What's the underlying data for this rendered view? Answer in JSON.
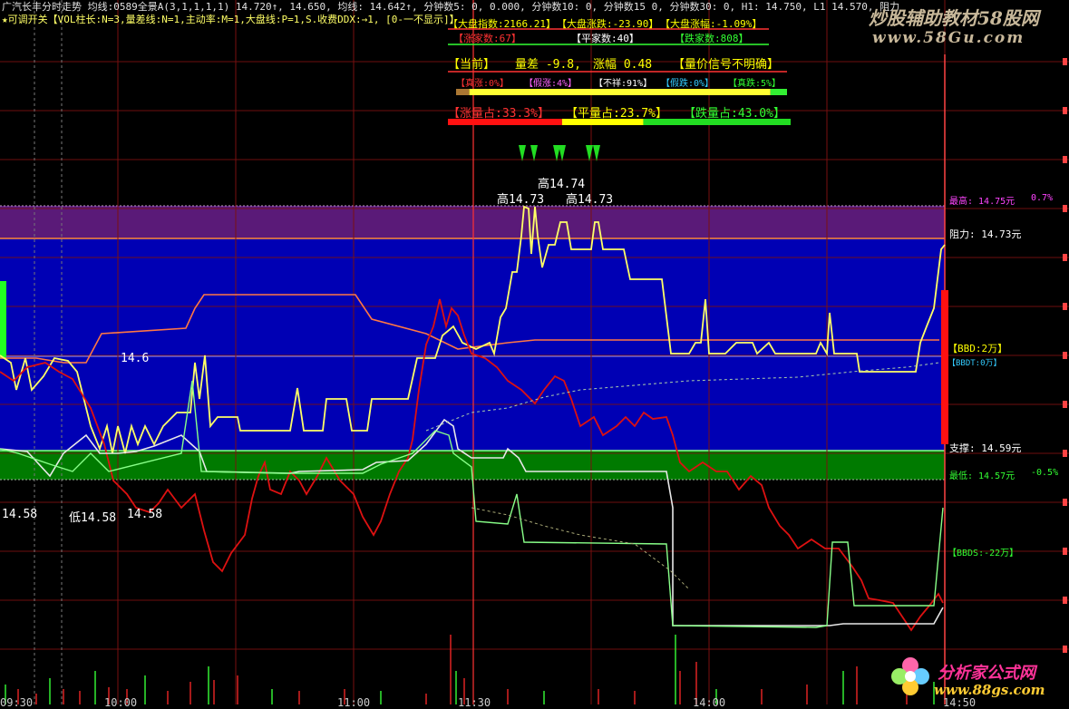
{
  "colors": {
    "background": "#000000",
    "grid": "#7a1010",
    "price_line": "#ffff66",
    "avg_line": "#ff6633",
    "red_line": "#dd1111",
    "white_line": "#e8e8e8",
    "green_line": "#66ff66",
    "zone_blue": "#0000b4",
    "zone_purple": "#5a1a78",
    "zone_green": "#007a00",
    "label_magenta": "#ff44ff",
    "label_yellow": "#ffff00",
    "label_green": "#33ff33",
    "label_cyan": "#33ccff"
  },
  "header": {
    "line1": "广汽长丰分时走势  均线:0589全景A(3,1,1,1,1) 14.720↑, 14.650, 均线: 14.642↑, 分钟数5: 0, 0.000, 分钟数10: 0, 分钟数15  0, 分钟数30: 0, H1: 14.750, L1  14.570, 阻力",
    "line2": "★可调开关【VOL柱长:N=3,量差线:N=1,主动率:M=1,大盘线:P=1,S.收费DDX:→1, [0-一不显示]】"
  },
  "market_panel": {
    "index": "【大盘指数:2166.21】",
    "index_change": "【大盘涨跌:-23.90】",
    "index_pct": "【大盘涨幅:-1.09%】",
    "up_count": "【涨家数:67】",
    "flat_count": "【平家数:40】",
    "down_count": "【跌家数:808】",
    "current_tag": "【当前】",
    "vol_diff": "量差 -9.8,",
    "change_pct": "涨幅 0.48",
    "signal": "【量价信号不明确】",
    "real_up": "【真涨:0%】",
    "fake_up": "【假涨:4%】",
    "unclear": "【不祥:91%】",
    "fake_down": "【假跌:0%】",
    "real_down": "【真跌:5%】",
    "up_vol": "【涨量占:33.3%】",
    "flat_vol": "【平量占:23.7%】",
    "down_vol": "【跌量占:43.0%】",
    "ratios": {
      "real_up": 0.0,
      "fake_up": 0.04,
      "unclear": 0.91,
      "fake_down": 0.0,
      "real_down": 0.05,
      "up_vol": 0.333,
      "flat_vol": 0.237,
      "down_vol": 0.43
    }
  },
  "annotations": {
    "high1": "高14.74",
    "high2": "高14.73",
    "high3": "高14.73",
    "price_mid": "14.6",
    "price_left": "14.58",
    "low_label": "低14.58",
    "low_label2": "14.58"
  },
  "right_labels": {
    "max": "最高: 14.75元",
    "max_pct": "0.7%",
    "resistance": "阻力: 14.73元",
    "bbd": "【BBD:2万】",
    "bbdt": "【BBDT:0万】",
    "support": "支撑: 14.59元",
    "min": "最低: 14.57元",
    "min_pct": "-0.5%",
    "bbds": "【BBDS:-22万】"
  },
  "x_axis": [
    "09:30",
    "10:00",
    "11:00",
    "11:30",
    "14:00",
    "14:50"
  ],
  "watermarks": {
    "top": "炒股辅助教材58股网",
    "top_url": "www.58Gu.com",
    "bottom": "分析家公式网",
    "bottom_url": "www.88gs.com"
  }
}
